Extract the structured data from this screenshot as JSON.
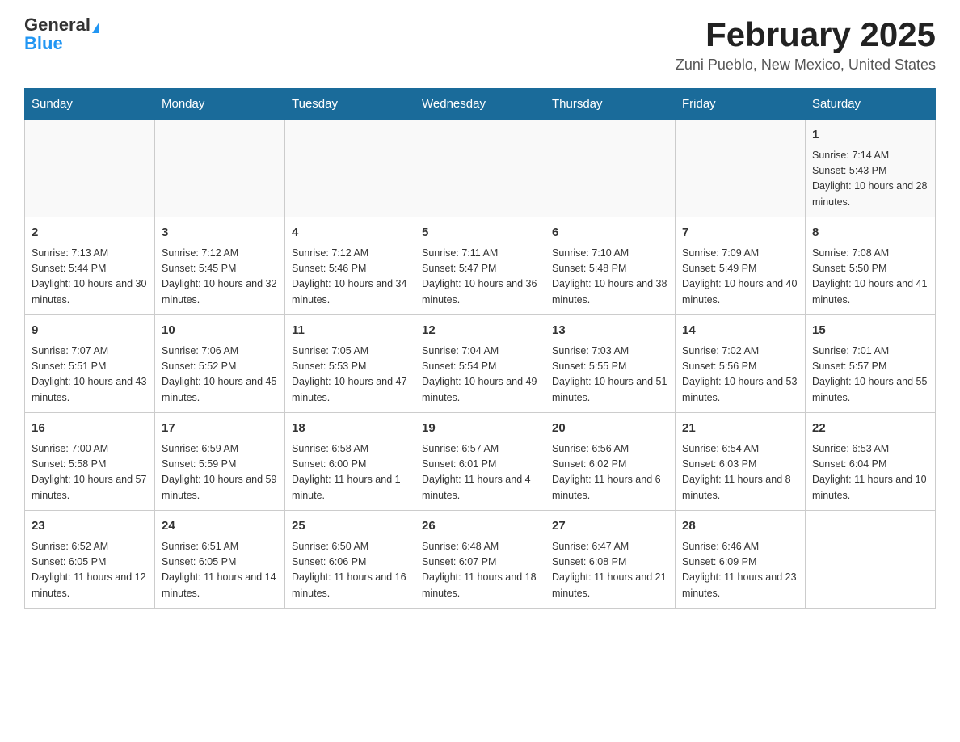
{
  "header": {
    "logo_general": "General",
    "logo_blue": "Blue",
    "month_title": "February 2025",
    "location": "Zuni Pueblo, New Mexico, United States"
  },
  "days_of_week": [
    "Sunday",
    "Monday",
    "Tuesday",
    "Wednesday",
    "Thursday",
    "Friday",
    "Saturday"
  ],
  "weeks": [
    [
      {
        "day": "",
        "info": ""
      },
      {
        "day": "",
        "info": ""
      },
      {
        "day": "",
        "info": ""
      },
      {
        "day": "",
        "info": ""
      },
      {
        "day": "",
        "info": ""
      },
      {
        "day": "",
        "info": ""
      },
      {
        "day": "1",
        "info": "Sunrise: 7:14 AM\nSunset: 5:43 PM\nDaylight: 10 hours and 28 minutes."
      }
    ],
    [
      {
        "day": "2",
        "info": "Sunrise: 7:13 AM\nSunset: 5:44 PM\nDaylight: 10 hours and 30 minutes."
      },
      {
        "day": "3",
        "info": "Sunrise: 7:12 AM\nSunset: 5:45 PM\nDaylight: 10 hours and 32 minutes."
      },
      {
        "day": "4",
        "info": "Sunrise: 7:12 AM\nSunset: 5:46 PM\nDaylight: 10 hours and 34 minutes."
      },
      {
        "day": "5",
        "info": "Sunrise: 7:11 AM\nSunset: 5:47 PM\nDaylight: 10 hours and 36 minutes."
      },
      {
        "day": "6",
        "info": "Sunrise: 7:10 AM\nSunset: 5:48 PM\nDaylight: 10 hours and 38 minutes."
      },
      {
        "day": "7",
        "info": "Sunrise: 7:09 AM\nSunset: 5:49 PM\nDaylight: 10 hours and 40 minutes."
      },
      {
        "day": "8",
        "info": "Sunrise: 7:08 AM\nSunset: 5:50 PM\nDaylight: 10 hours and 41 minutes."
      }
    ],
    [
      {
        "day": "9",
        "info": "Sunrise: 7:07 AM\nSunset: 5:51 PM\nDaylight: 10 hours and 43 minutes."
      },
      {
        "day": "10",
        "info": "Sunrise: 7:06 AM\nSunset: 5:52 PM\nDaylight: 10 hours and 45 minutes."
      },
      {
        "day": "11",
        "info": "Sunrise: 7:05 AM\nSunset: 5:53 PM\nDaylight: 10 hours and 47 minutes."
      },
      {
        "day": "12",
        "info": "Sunrise: 7:04 AM\nSunset: 5:54 PM\nDaylight: 10 hours and 49 minutes."
      },
      {
        "day": "13",
        "info": "Sunrise: 7:03 AM\nSunset: 5:55 PM\nDaylight: 10 hours and 51 minutes."
      },
      {
        "day": "14",
        "info": "Sunrise: 7:02 AM\nSunset: 5:56 PM\nDaylight: 10 hours and 53 minutes."
      },
      {
        "day": "15",
        "info": "Sunrise: 7:01 AM\nSunset: 5:57 PM\nDaylight: 10 hours and 55 minutes."
      }
    ],
    [
      {
        "day": "16",
        "info": "Sunrise: 7:00 AM\nSunset: 5:58 PM\nDaylight: 10 hours and 57 minutes."
      },
      {
        "day": "17",
        "info": "Sunrise: 6:59 AM\nSunset: 5:59 PM\nDaylight: 10 hours and 59 minutes."
      },
      {
        "day": "18",
        "info": "Sunrise: 6:58 AM\nSunset: 6:00 PM\nDaylight: 11 hours and 1 minute."
      },
      {
        "day": "19",
        "info": "Sunrise: 6:57 AM\nSunset: 6:01 PM\nDaylight: 11 hours and 4 minutes."
      },
      {
        "day": "20",
        "info": "Sunrise: 6:56 AM\nSunset: 6:02 PM\nDaylight: 11 hours and 6 minutes."
      },
      {
        "day": "21",
        "info": "Sunrise: 6:54 AM\nSunset: 6:03 PM\nDaylight: 11 hours and 8 minutes."
      },
      {
        "day": "22",
        "info": "Sunrise: 6:53 AM\nSunset: 6:04 PM\nDaylight: 11 hours and 10 minutes."
      }
    ],
    [
      {
        "day": "23",
        "info": "Sunrise: 6:52 AM\nSunset: 6:05 PM\nDaylight: 11 hours and 12 minutes."
      },
      {
        "day": "24",
        "info": "Sunrise: 6:51 AM\nSunset: 6:05 PM\nDaylight: 11 hours and 14 minutes."
      },
      {
        "day": "25",
        "info": "Sunrise: 6:50 AM\nSunset: 6:06 PM\nDaylight: 11 hours and 16 minutes."
      },
      {
        "day": "26",
        "info": "Sunrise: 6:48 AM\nSunset: 6:07 PM\nDaylight: 11 hours and 18 minutes."
      },
      {
        "day": "27",
        "info": "Sunrise: 6:47 AM\nSunset: 6:08 PM\nDaylight: 11 hours and 21 minutes."
      },
      {
        "day": "28",
        "info": "Sunrise: 6:46 AM\nSunset: 6:09 PM\nDaylight: 11 hours and 23 minutes."
      },
      {
        "day": "",
        "info": ""
      }
    ]
  ]
}
